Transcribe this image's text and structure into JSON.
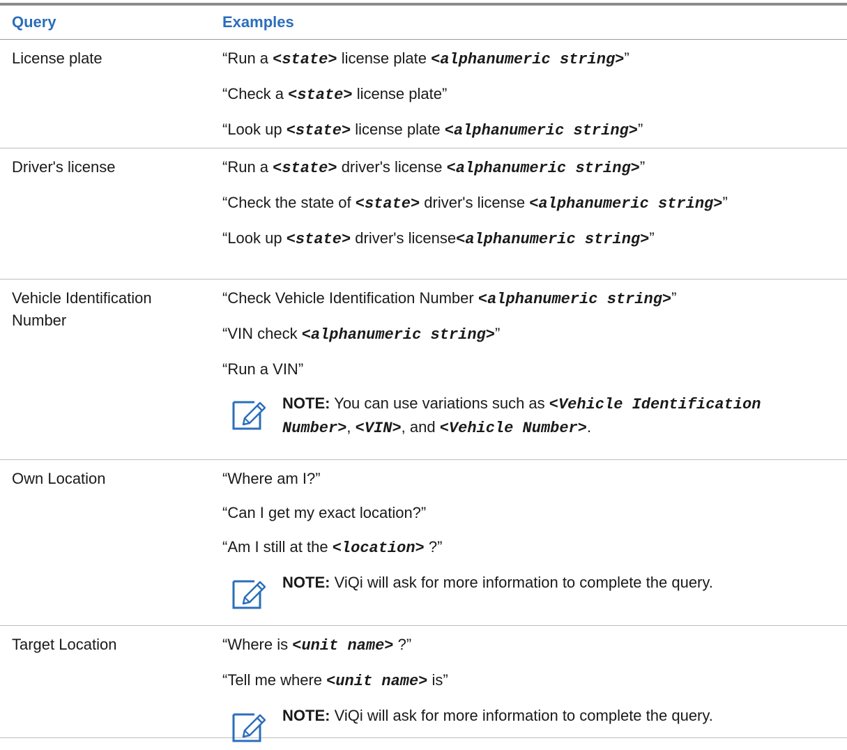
{
  "header": {
    "query": "Query",
    "examples": "Examples"
  },
  "rows": [
    {
      "query": "License plate",
      "examples": [
        {
          "pre": "“Run a ",
          "ph1": "<state>",
          "mid": " license plate ",
          "ph2": "<alphanumeric string>",
          "post": "”"
        },
        {
          "pre": "“Check a ",
          "ph1": "<state>",
          "mid": " license plate”"
        },
        {
          "pre": "“Look up ",
          "ph1": "<state>",
          "mid": " license plate ",
          "ph2": "<alphanumeric string>",
          "post": "”"
        }
      ]
    },
    {
      "query": "Driver's license",
      "examples": [
        {
          "pre": "“Run a ",
          "ph1": "<state>",
          "mid": " driver's license ",
          "ph2": "<alphanumeric string>",
          "post": "”"
        },
        {
          "pre": "“Check the state of ",
          "ph1": "<state>",
          "mid": " driver's license ",
          "ph2": "<alphanumeric string>",
          "post": "”"
        },
        {
          "pre": "“Look up ",
          "ph1": "<state>",
          "mid": " driver's license",
          "ph2": "<alphanumeric string>",
          "post": "”"
        }
      ]
    },
    {
      "query": "Vehicle Identification Number",
      "examples": [
        {
          "pre": "“Check Vehicle Identification Number ",
          "ph1": "<alphanumeric string>",
          "mid": "”"
        },
        {
          "pre": "“VIN check ",
          "ph1": "<alphanumeric string>",
          "mid": "”"
        },
        {
          "pre": "“Run a VIN”"
        }
      ],
      "note": {
        "label": "NOTE:",
        "t1": " You can use variations such as ",
        "p1": "<Vehicle Identification Number>",
        "t2": ", ",
        "p2": "<VIN>",
        "t3": ", and ",
        "p3": "<Vehicle Number>",
        "t4": "."
      }
    },
    {
      "query": "Own Location",
      "examples": [
        {
          "pre": "“Where am I?”"
        },
        {
          "pre": "“Can I get my exact location?”"
        },
        {
          "pre": "“Am I still at the ",
          "ph1": "<location>",
          "mid": " ?”"
        }
      ],
      "note": {
        "label": "NOTE:",
        "t1": " ViQi will ask for more information to complete the query."
      }
    },
    {
      "query": "Target Location",
      "examples": [
        {
          "pre": "“Where is ",
          "ph1": "<unit name>",
          "mid": " ?”"
        },
        {
          "pre": "“Tell me where ",
          "ph1": "<unit name>",
          "mid": " is”"
        }
      ],
      "note": {
        "label": "NOTE:",
        "t1": " ViQi will ask for more information to complete the query."
      }
    }
  ],
  "icons": {
    "note": "note-pencil-icon"
  },
  "colors": {
    "header_text": "#2a6ebb",
    "note_icon": "#2a6ebb",
    "rule": "#8c8c8c"
  }
}
